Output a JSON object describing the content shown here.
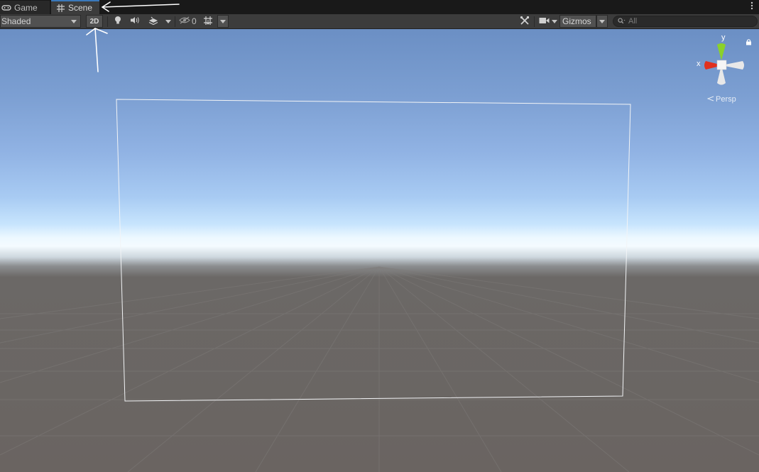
{
  "tabs": [
    {
      "label": "Game",
      "icon": "gamepad-icon",
      "active": false
    },
    {
      "label": "Scene",
      "icon": "grid-icon",
      "active": true
    }
  ],
  "toolbar": {
    "shading_mode": "Shaded",
    "toggle_2d_label": "2D",
    "hidden_objects_count": "0",
    "gizmos_label": "Gizmos",
    "search_placeholder": "All",
    "search_value": ""
  },
  "gizmo": {
    "x_label": "x",
    "y_label": "y",
    "projection_label": "Persp"
  },
  "colors": {
    "tab_active_accent": "#3a79bb",
    "axis_x": "#e0301e",
    "axis_y": "#8bd12a",
    "sky_top": "#6b8fc4",
    "horizon": "#f4fbff",
    "ground": "#6a6461"
  }
}
